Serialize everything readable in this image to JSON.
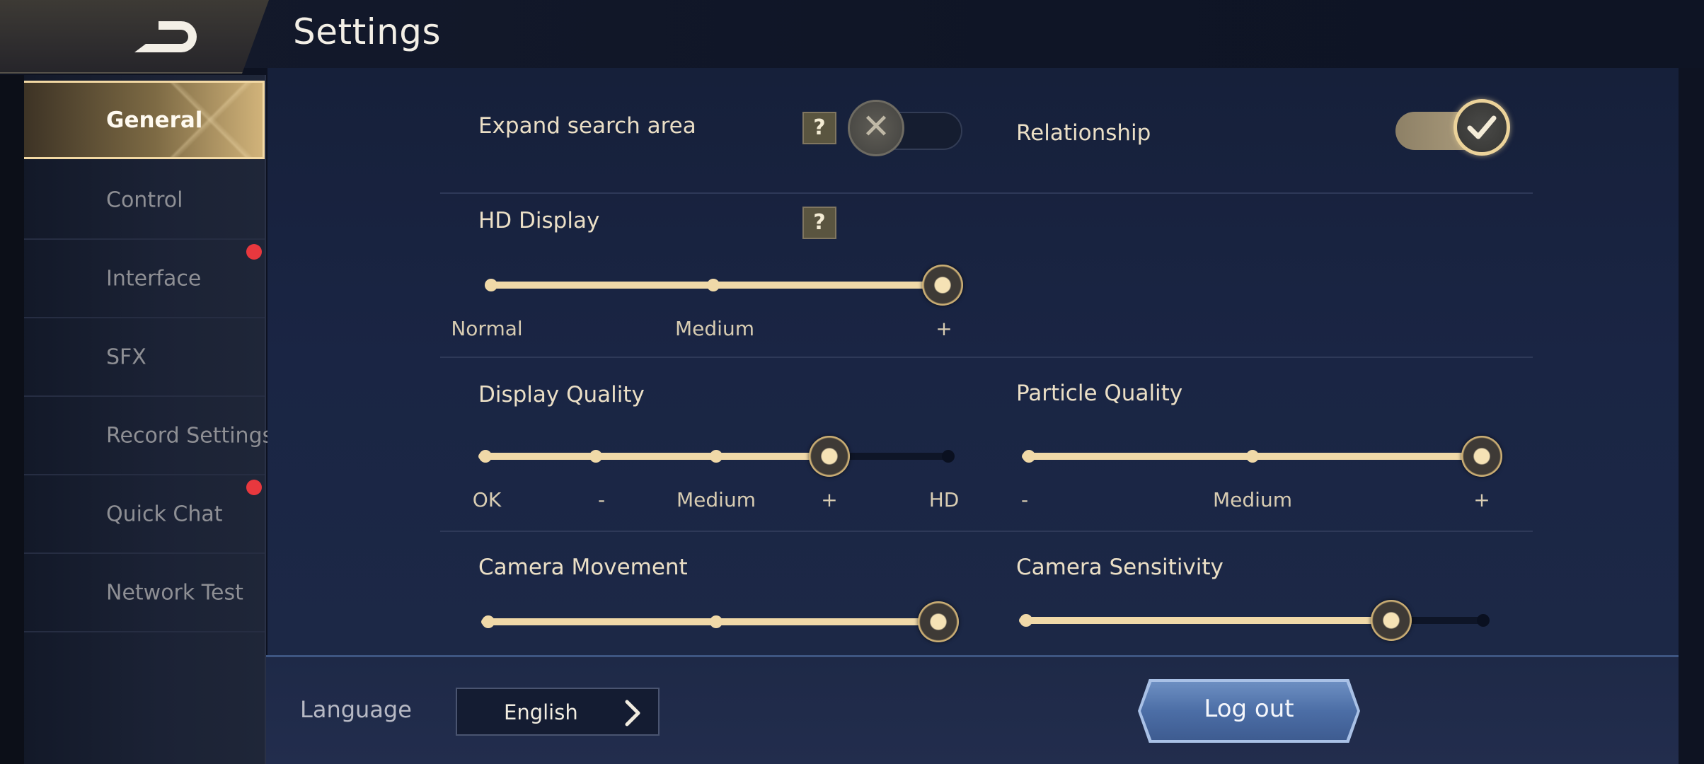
{
  "header": {
    "title": "Settings",
    "back_icon": "back-arrow-icon"
  },
  "sidebar": {
    "items": [
      {
        "label": "General",
        "active": true,
        "badge": false
      },
      {
        "label": "Control",
        "active": false,
        "badge": false
      },
      {
        "label": "Interface",
        "active": false,
        "badge": true
      },
      {
        "label": "SFX",
        "active": false,
        "badge": false
      },
      {
        "label": "Record Settings",
        "active": false,
        "badge": false
      },
      {
        "label": "Quick Chat",
        "active": false,
        "badge": true
      },
      {
        "label": "Network Test",
        "active": false,
        "badge": false
      }
    ]
  },
  "settings": {
    "expand_search": {
      "label": "Expand search area",
      "help": "?",
      "enabled": false
    },
    "relationship": {
      "label": "Relationship",
      "enabled": true
    },
    "hd_display": {
      "label": "HD Display",
      "help": "?",
      "ticks": [
        "Normal",
        "Medium",
        "+"
      ],
      "selected_index": 2
    },
    "display_quality": {
      "label": "Display Quality",
      "ticks": [
        "OK",
        "-",
        "Medium",
        "+",
        "HD"
      ],
      "selected_index": 3
    },
    "particle_quality": {
      "label": "Particle Quality",
      "ticks": [
        "-",
        "Medium",
        "+"
      ],
      "selected_index": 2
    },
    "camera_movement": {
      "label": "Camera Movement",
      "level": 1.0
    },
    "camera_sensitivity": {
      "label": "Camera Sensitivity",
      "level": 0.8
    }
  },
  "footer": {
    "language_label": "Language",
    "language_value": "English",
    "logout_label": "Log out"
  },
  "colors": {
    "accent_gold": "#f0d9a8",
    "badge_red": "#e8383e",
    "logout_blue": "#4c6ea6"
  }
}
